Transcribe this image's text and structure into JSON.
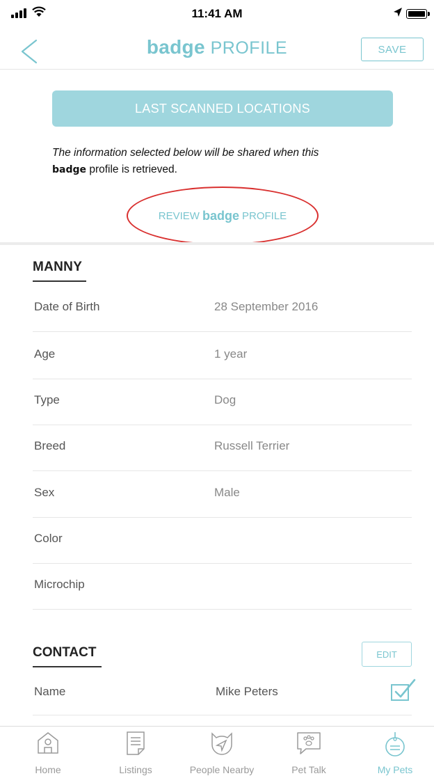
{
  "status_bar": {
    "time": "11:41 AM"
  },
  "header": {
    "back_icon": "chevron-left-icon",
    "title_brand": "badge",
    "title_suffix": "PROFILE",
    "save_label": "SAVE"
  },
  "last_scanned_label": "LAST SCANNED LOCATIONS",
  "info": {
    "line1": "The information selected below will be shared when this",
    "brand": "badge",
    "line2": " profile is retrieved."
  },
  "review": {
    "prefix": "REVIEW",
    "brand": "badge",
    "suffix": "PROFILE"
  },
  "pet": {
    "name": "MANNY",
    "details": [
      {
        "label": "Date of Birth",
        "value": "28 September 2016"
      },
      {
        "label": "Age",
        "value": "1 year"
      },
      {
        "label": "Type",
        "value": "Dog"
      },
      {
        "label": "Breed",
        "value": "Russell Terrier"
      },
      {
        "label": "Sex",
        "value": "Male"
      },
      {
        "label": "Color",
        "value": ""
      },
      {
        "label": "Microchip",
        "value": ""
      }
    ]
  },
  "contact": {
    "title": "CONTACT",
    "edit_label": "EDIT",
    "rows": [
      {
        "label": "Name",
        "value": "Mike Peters",
        "checked": true
      }
    ]
  },
  "tabs": [
    {
      "label": "Home",
      "icon": "home-icon",
      "active": false
    },
    {
      "label": "Listings",
      "icon": "listings-icon",
      "active": false
    },
    {
      "label": "People Nearby",
      "icon": "cat-location-icon",
      "active": false
    },
    {
      "label": "Pet Talk",
      "icon": "paw-chat-icon",
      "active": false
    },
    {
      "label": "My Pets",
      "icon": "badge-tag-icon",
      "active": true
    }
  ],
  "colors": {
    "accent": "#79c5cf",
    "button_fill": "#9fd6de",
    "highlight_oval": "#d9302f"
  }
}
